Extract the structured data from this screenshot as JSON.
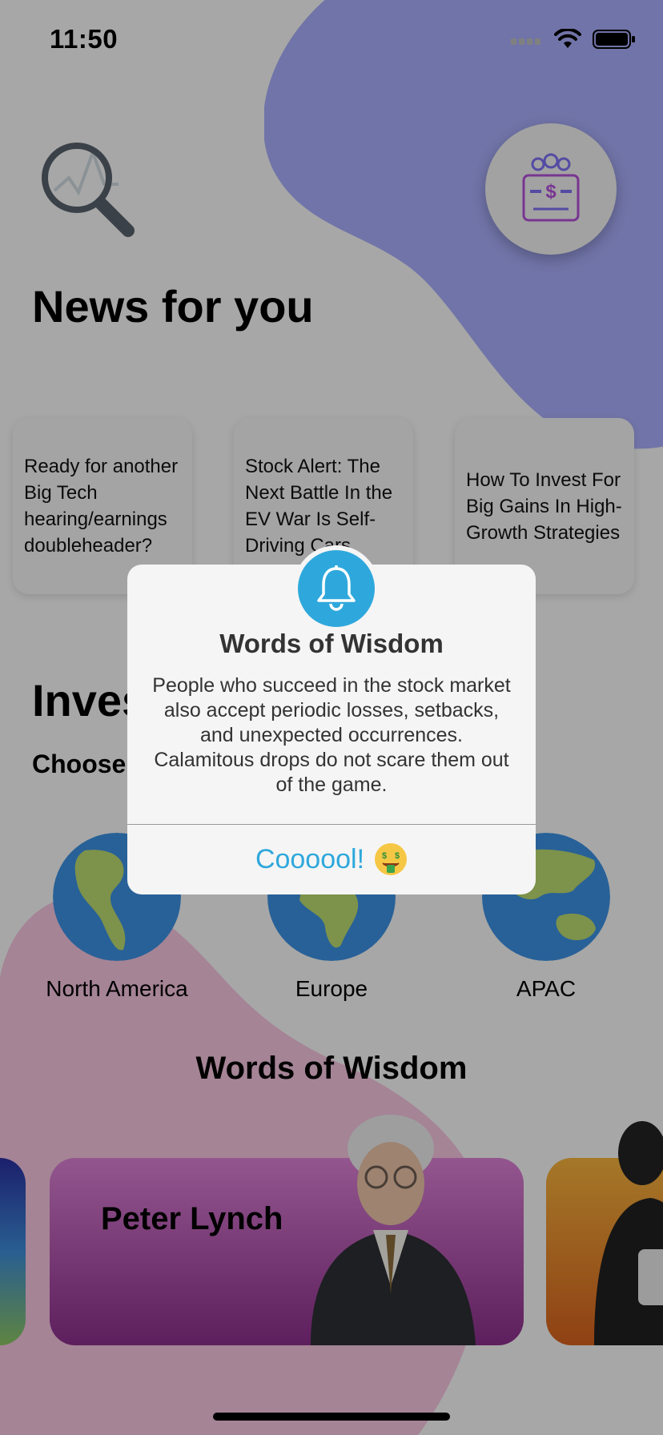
{
  "status_bar": {
    "time": "11:50"
  },
  "news": {
    "title": "News for you",
    "cards": [
      "Ready for another Big Tech hearing/earnings doubleheader?",
      "Stock Alert: The Next Battle In the EV War Is Self-Driving Cars",
      "How To Invest For Big Gains In High-Growth Strategies"
    ]
  },
  "invest": {
    "title": "Investment Masters",
    "subtitle": "Choose a region",
    "regions": [
      "North America",
      "Europe",
      "APAC"
    ]
  },
  "wisdom": {
    "heading": "Words of Wisdom",
    "cards": [
      {
        "name": "Peter Lynch"
      }
    ]
  },
  "alert": {
    "icon": "bell-icon",
    "title": "Words of Wisdom",
    "message": "People who succeed in the stock market also accept periodic losses, setbacks, and unexpected occurrences. Calamitous drops do not scare them out of the game.",
    "button_label": "Coooool!",
    "button_emoji": "money-mouth-face-icon"
  },
  "colors": {
    "accent": "#2ea8dc",
    "blob_top": "#a7acf8",
    "blob_bottom": "#f3c3dd",
    "card_main_top": "#d97fd2",
    "card_main_bottom": "#8a2e8a"
  }
}
